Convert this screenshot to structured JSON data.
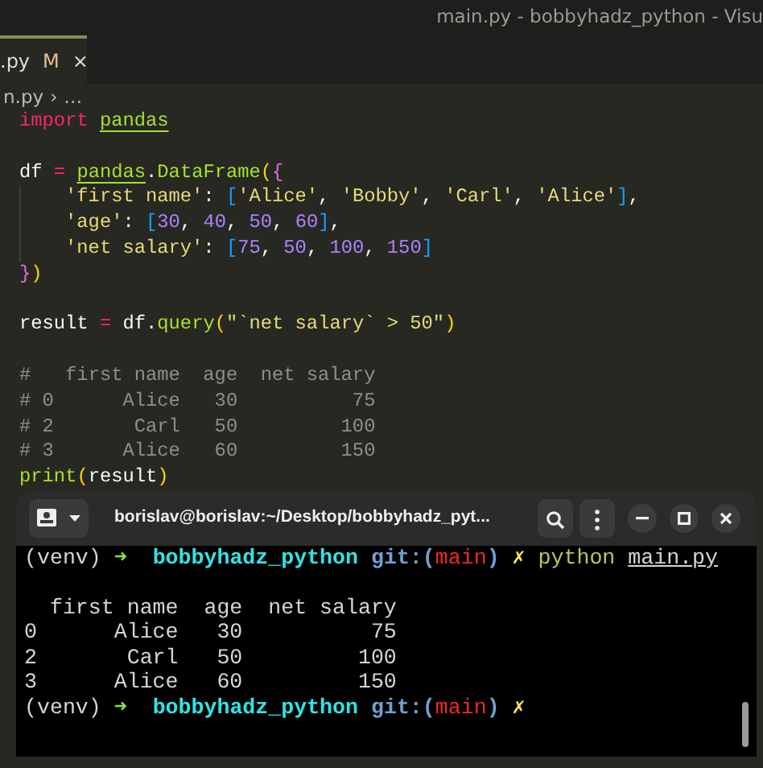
{
  "window": {
    "title": "main.py - bobbyhadz_python - Visu"
  },
  "tabs": [
    {
      "label": ".py",
      "badge": "M",
      "close": "×",
      "selected": true
    }
  ],
  "breadcrumb": [
    "n.py",
    "›",
    "…"
  ],
  "code_lines": [
    {
      "kind": "code",
      "indented": false,
      "segments": [
        {
          "text": "import ",
          "kind": "keyword"
        },
        {
          "text": "pandas",
          "kind": "module"
        }
      ]
    },
    {
      "kind": "blank"
    },
    {
      "kind": "code",
      "indented": false,
      "segments": [
        {
          "text": "df ",
          "kind": "plain"
        },
        {
          "text": "= ",
          "kind": "operator"
        },
        {
          "text": "pandas",
          "kind": "module"
        },
        {
          "text": ".",
          "kind": "plain"
        },
        {
          "text": "DataFrame",
          "kind": "func"
        },
        {
          "text": "(",
          "kind": "bracket1"
        },
        {
          "text": "{",
          "kind": "bracket2"
        }
      ]
    },
    {
      "kind": "code",
      "indented": true,
      "segments": [
        {
          "text": "'first name'",
          "kind": "string"
        },
        {
          "text": ": ",
          "kind": "plain"
        },
        {
          "text": "[",
          "kind": "bracket3"
        },
        {
          "text": "'Alice'",
          "kind": "string"
        },
        {
          "text": ", ",
          "kind": "plain"
        },
        {
          "text": "'Bobby'",
          "kind": "string"
        },
        {
          "text": ", ",
          "kind": "plain"
        },
        {
          "text": "'Carl'",
          "kind": "string"
        },
        {
          "text": ", ",
          "kind": "plain"
        },
        {
          "text": "'Alice'",
          "kind": "string"
        },
        {
          "text": "]",
          "kind": "bracket3"
        },
        {
          "text": ",",
          "kind": "plain"
        }
      ]
    },
    {
      "kind": "code",
      "indented": true,
      "segments": [
        {
          "text": "'age'",
          "kind": "string"
        },
        {
          "text": ": ",
          "kind": "plain"
        },
        {
          "text": "[",
          "kind": "bracket3"
        },
        {
          "text": "30",
          "kind": "number"
        },
        {
          "text": ", ",
          "kind": "plain"
        },
        {
          "text": "40",
          "kind": "number"
        },
        {
          "text": ", ",
          "kind": "plain"
        },
        {
          "text": "50",
          "kind": "number"
        },
        {
          "text": ", ",
          "kind": "plain"
        },
        {
          "text": "60",
          "kind": "number"
        },
        {
          "text": "]",
          "kind": "bracket3"
        },
        {
          "text": ",",
          "kind": "plain"
        }
      ]
    },
    {
      "kind": "code",
      "indented": true,
      "segments": [
        {
          "text": "'net salary'",
          "kind": "string"
        },
        {
          "text": ": ",
          "kind": "plain"
        },
        {
          "text": "[",
          "kind": "bracket3"
        },
        {
          "text": "75",
          "kind": "number"
        },
        {
          "text": ", ",
          "kind": "plain"
        },
        {
          "text": "50",
          "kind": "number"
        },
        {
          "text": ", ",
          "kind": "plain"
        },
        {
          "text": "100",
          "kind": "number"
        },
        {
          "text": ", ",
          "kind": "plain"
        },
        {
          "text": "150",
          "kind": "number"
        },
        {
          "text": "]",
          "kind": "bracket3"
        }
      ]
    },
    {
      "kind": "code",
      "indented": false,
      "segments": [
        {
          "text": "}",
          "kind": "bracket2"
        },
        {
          "text": ")",
          "kind": "bracket1"
        }
      ]
    },
    {
      "kind": "blank"
    },
    {
      "kind": "code",
      "indented": false,
      "segments": [
        {
          "text": "result ",
          "kind": "plain"
        },
        {
          "text": "= ",
          "kind": "operator"
        },
        {
          "text": "df.",
          "kind": "plain"
        },
        {
          "text": "query",
          "kind": "func"
        },
        {
          "text": "(",
          "kind": "bracket1"
        },
        {
          "text": "\"`net salary` > 50\"",
          "kind": "string"
        },
        {
          "text": ")",
          "kind": "bracket1"
        }
      ]
    },
    {
      "kind": "blank"
    },
    {
      "kind": "code",
      "indented": false,
      "segments": [
        {
          "text": "#   first name  age  net salary",
          "kind": "comment"
        }
      ]
    },
    {
      "kind": "code",
      "indented": false,
      "segments": [
        {
          "text": "# 0      Alice   30          75",
          "kind": "comment"
        }
      ]
    },
    {
      "kind": "code",
      "indented": false,
      "segments": [
        {
          "text": "# 2       Carl   50         100",
          "kind": "comment"
        }
      ]
    },
    {
      "kind": "code",
      "indented": false,
      "segments": [
        {
          "text": "# 3      Alice   60         150",
          "kind": "comment"
        }
      ]
    },
    {
      "kind": "code",
      "indented": false,
      "segments": [
        {
          "text": "print",
          "kind": "func"
        },
        {
          "text": "(",
          "kind": "bracket1"
        },
        {
          "text": "result",
          "kind": "plain"
        },
        {
          "text": ")",
          "kind": "bracket1"
        }
      ]
    }
  ],
  "terminal": {
    "title": "borislav@borislav:~/Desktop/bobbyhadz_pyt...",
    "lines": [
      {
        "kind": "text",
        "segments": [
          {
            "text": "(venv) ",
            "kind": "plain"
          },
          {
            "text": "➜  ",
            "kind": "arrow"
          },
          {
            "text": "bobbyhadz_python ",
            "kind": "dir"
          },
          {
            "text": "git:(",
            "kind": "git"
          },
          {
            "text": "main",
            "kind": "branch"
          },
          {
            "text": ") ",
            "kind": "git"
          },
          {
            "text": "✗ ",
            "kind": "dirty"
          },
          {
            "text": "python ",
            "kind": "cmd"
          },
          {
            "text": "main.py",
            "kind": "file"
          }
        ]
      },
      {
        "kind": "blank"
      },
      {
        "kind": "text",
        "segments": [
          {
            "text": "  first name  age  net salary",
            "kind": "plain"
          }
        ]
      },
      {
        "kind": "text",
        "segments": [
          {
            "text": "0      Alice   30          75",
            "kind": "plain"
          }
        ]
      },
      {
        "kind": "text",
        "segments": [
          {
            "text": "2       Carl   50         100",
            "kind": "plain"
          }
        ]
      },
      {
        "kind": "text",
        "segments": [
          {
            "text": "3      Alice   60         150",
            "kind": "plain"
          }
        ]
      },
      {
        "kind": "text",
        "segments": [
          {
            "text": "(venv) ",
            "kind": "plain"
          },
          {
            "text": "➜  ",
            "kind": "arrow"
          },
          {
            "text": "bobbyhadz_python ",
            "kind": "dir"
          },
          {
            "text": "git:(",
            "kind": "git"
          },
          {
            "text": "main",
            "kind": "branch"
          },
          {
            "text": ") ",
            "kind": "git"
          },
          {
            "text": "✗",
            "kind": "dirty"
          }
        ]
      }
    ]
  }
}
